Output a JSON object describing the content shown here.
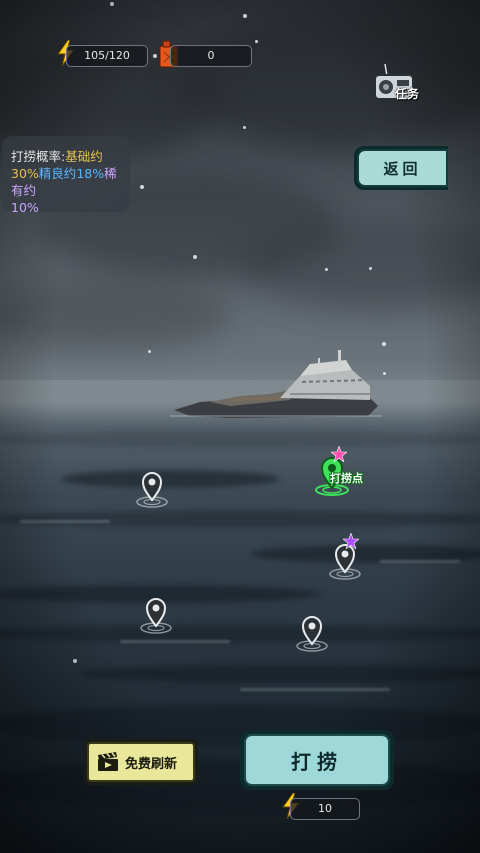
{
  "resources": {
    "energy": "105/120",
    "fuel": "0"
  },
  "task": {
    "label": "任务"
  },
  "info": {
    "prefix": "打捞概率:",
    "basic_label": "基础约",
    "basic_pct": "30%",
    "fine_label": "精良约",
    "fine_pct": "18%",
    "rare_label": "稀有约",
    "rare_pct": "10%"
  },
  "back": {
    "label": "返回"
  },
  "map": {
    "salvage_point_label": "打捞点",
    "pins": [
      "pin-1",
      "pin-2",
      "pin-3",
      "pin-4",
      "pin-5"
    ]
  },
  "bottom": {
    "free_refresh_label": "免费刷新",
    "salvage_label": "打捞",
    "energy_cost": "10"
  },
  "colors": {
    "basic": "#e6c24a",
    "fine": "#56b7ff",
    "rare": "#c9a6ff",
    "salvage_green": "#3fe05a",
    "star_pink": "#ff4fb4",
    "star_purple": "#b04cff",
    "energy_yellow": "#ffd21a",
    "fuel_orange": "#e8571b"
  }
}
